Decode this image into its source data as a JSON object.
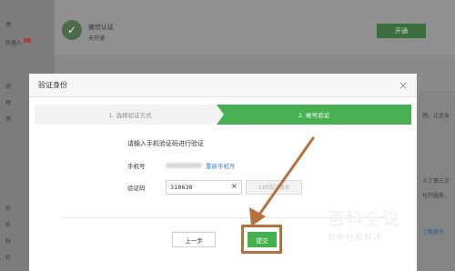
{
  "background": {
    "account_title": "微信认证",
    "account_sub": "未开通",
    "action_button": "开通",
    "left_items": [
      "理",
      "理",
      "理",
      "理",
      "理",
      "析",
      "析",
      "析",
      "析"
    ],
    "left_badge_text": "机器人",
    "right_items": [
      "例，让企业",
      "人了第三方",
      "化的服务，",
      "了解更多"
    ]
  },
  "modal": {
    "title": "验证身份",
    "close": "×",
    "steps": [
      {
        "label": "1. 选择验证方式",
        "active": false
      },
      {
        "label": "2. 帐号验证",
        "active": true
      }
    ],
    "hint": "请输入手机验证码进行验证",
    "phone_label": "手机号",
    "rebind_link": "重新手机号",
    "code_label": "验证码",
    "code_value": "318638",
    "clear_icon": "×",
    "resend_label": "13秒后可重发",
    "prev_button": "上一步",
    "submit_button": "提交"
  },
  "watermark": {
    "big": "百科全说",
    "small": "助你轻松解决"
  },
  "colors": {
    "accent_green": "#48b052",
    "highlight": "#b5703e",
    "link": "#3b7fd3"
  }
}
